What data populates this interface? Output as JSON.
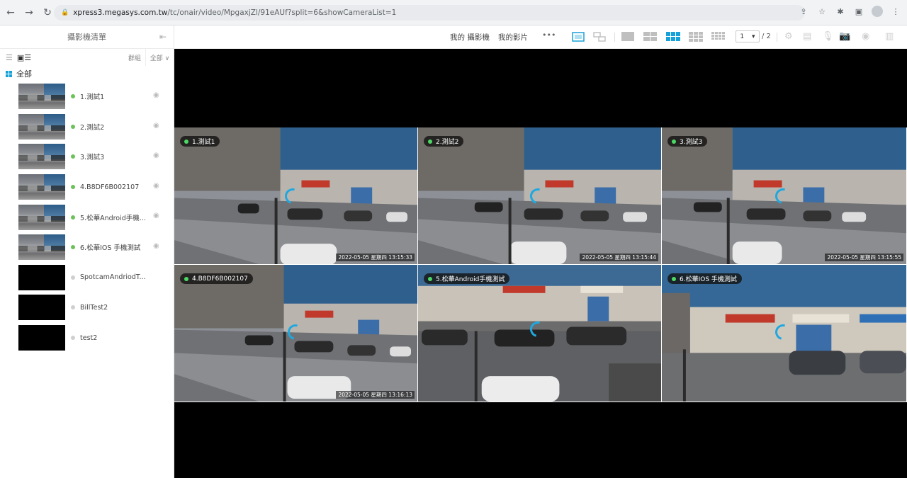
{
  "browser": {
    "url_host": "xpress3.megasys.com.tw",
    "url_path": "/tc/onair/video/MpgaxjZl/91eAUf?split=6&showCameraList=1"
  },
  "sidebar": {
    "title": "攝影機清單",
    "group_label": "群組",
    "filter_label": "全部 ∨",
    "all_label": "全部",
    "cameras": [
      {
        "name": "1.測試1",
        "online": true
      },
      {
        "name": "2.測試2",
        "online": true
      },
      {
        "name": "3.測試3",
        "online": true
      },
      {
        "name": "4.B8DF6B002107",
        "online": true
      },
      {
        "name": "5.松華Android手機...",
        "online": true
      },
      {
        "name": "6.松華IOS 手機測試",
        "online": true
      },
      {
        "name": "SpotcamAndriodT...",
        "online": false
      },
      {
        "name": "BillTest2",
        "online": false
      },
      {
        "name": "test2",
        "online": false
      }
    ]
  },
  "toolbar": {
    "my_cameras": "我的 攝影機",
    "my_videos": "我的影片",
    "more": "•••",
    "page_current": "1",
    "page_total": "/ 2"
  },
  "tiles": [
    {
      "label": "1.測試1",
      "timestamp": ""
    },
    {
      "label": "2.測試2",
      "timestamp": ""
    },
    {
      "label": "3.測試3",
      "timestamp": "2022-05-05 星期四 13:15:55"
    },
    {
      "label": "4.B8DF6B002107",
      "timestamp": "2022-05-05 星期四 13:16:13"
    },
    {
      "label": "5.松華Android手機測試",
      "timestamp": ""
    },
    {
      "label": "6.松華IOS 手機測試",
      "timestamp": ""
    }
  ],
  "tile_timestamps": {
    "t1": "2022-05-05 星期四 13:15:33",
    "t2": "2022-05-05 星期四 13:15:44"
  },
  "colors": {
    "accent": "#18a0d8",
    "online": "#6ac259"
  }
}
